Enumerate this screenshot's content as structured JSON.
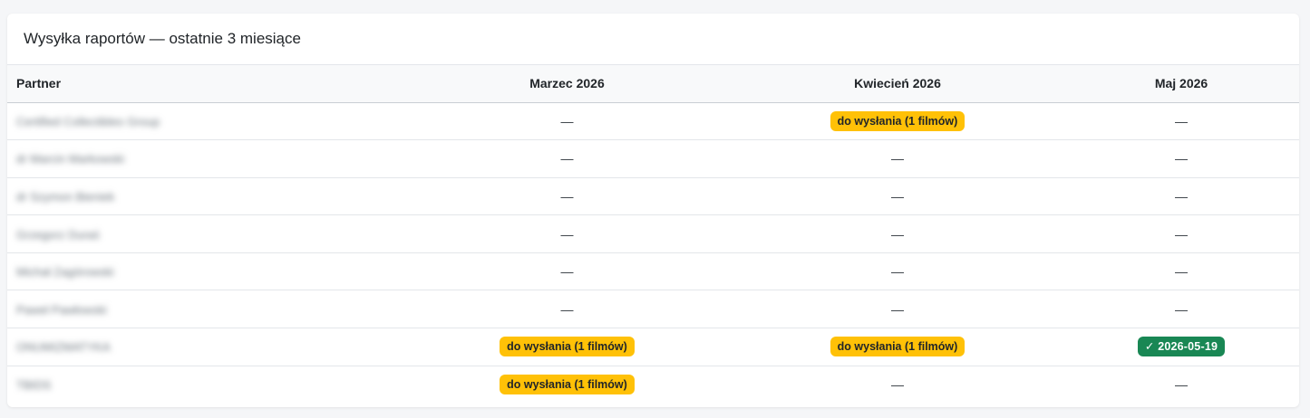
{
  "card": {
    "title": "Wysyłka raportów — ostatnie 3 miesiące"
  },
  "table": {
    "headers": [
      "Partner",
      "Marzec 2026",
      "Kwiecień 2026",
      "Maj 2026"
    ],
    "rows": [
      {
        "partner": "Certified Collectibles Group",
        "cells": [
          {
            "kind": "empty",
            "text": "—"
          },
          {
            "kind": "pending",
            "text": "do wysłania (1 filmów)"
          },
          {
            "kind": "empty",
            "text": "—"
          }
        ]
      },
      {
        "partner": "dr Marcin Markowski",
        "cells": [
          {
            "kind": "empty",
            "text": "—"
          },
          {
            "kind": "empty",
            "text": "—"
          },
          {
            "kind": "empty",
            "text": "—"
          }
        ]
      },
      {
        "partner": "dr Szymon Bieniek",
        "cells": [
          {
            "kind": "empty",
            "text": "—"
          },
          {
            "kind": "empty",
            "text": "—"
          },
          {
            "kind": "empty",
            "text": "—"
          }
        ]
      },
      {
        "partner": "Grzegorz Duraś",
        "cells": [
          {
            "kind": "empty",
            "text": "—"
          },
          {
            "kind": "empty",
            "text": "—"
          },
          {
            "kind": "empty",
            "text": "—"
          }
        ]
      },
      {
        "partner": "Michał Zagórowski",
        "cells": [
          {
            "kind": "empty",
            "text": "—"
          },
          {
            "kind": "empty",
            "text": "—"
          },
          {
            "kind": "empty",
            "text": "—"
          }
        ]
      },
      {
        "partner": "Paweł Pawłowski",
        "cells": [
          {
            "kind": "empty",
            "text": "—"
          },
          {
            "kind": "empty",
            "text": "—"
          },
          {
            "kind": "empty",
            "text": "—"
          }
        ]
      },
      {
        "partner": "ONUMIZMATYKA",
        "cells": [
          {
            "kind": "pending",
            "text": "do wysłania (1 filmów)"
          },
          {
            "kind": "pending",
            "text": "do wysłania (1 filmów)"
          },
          {
            "kind": "sent",
            "text": "✓ 2026-05-19"
          }
        ]
      },
      {
        "partner": "TBIDS",
        "cells": [
          {
            "kind": "pending",
            "text": "do wysłania (1 filmów)"
          },
          {
            "kind": "empty",
            "text": "—"
          },
          {
            "kind": "empty",
            "text": "—"
          }
        ]
      }
    ]
  },
  "colors": {
    "pending": "#ffc107",
    "sent": "#198754"
  },
  "icons": {
    "sent": "check-icon"
  }
}
